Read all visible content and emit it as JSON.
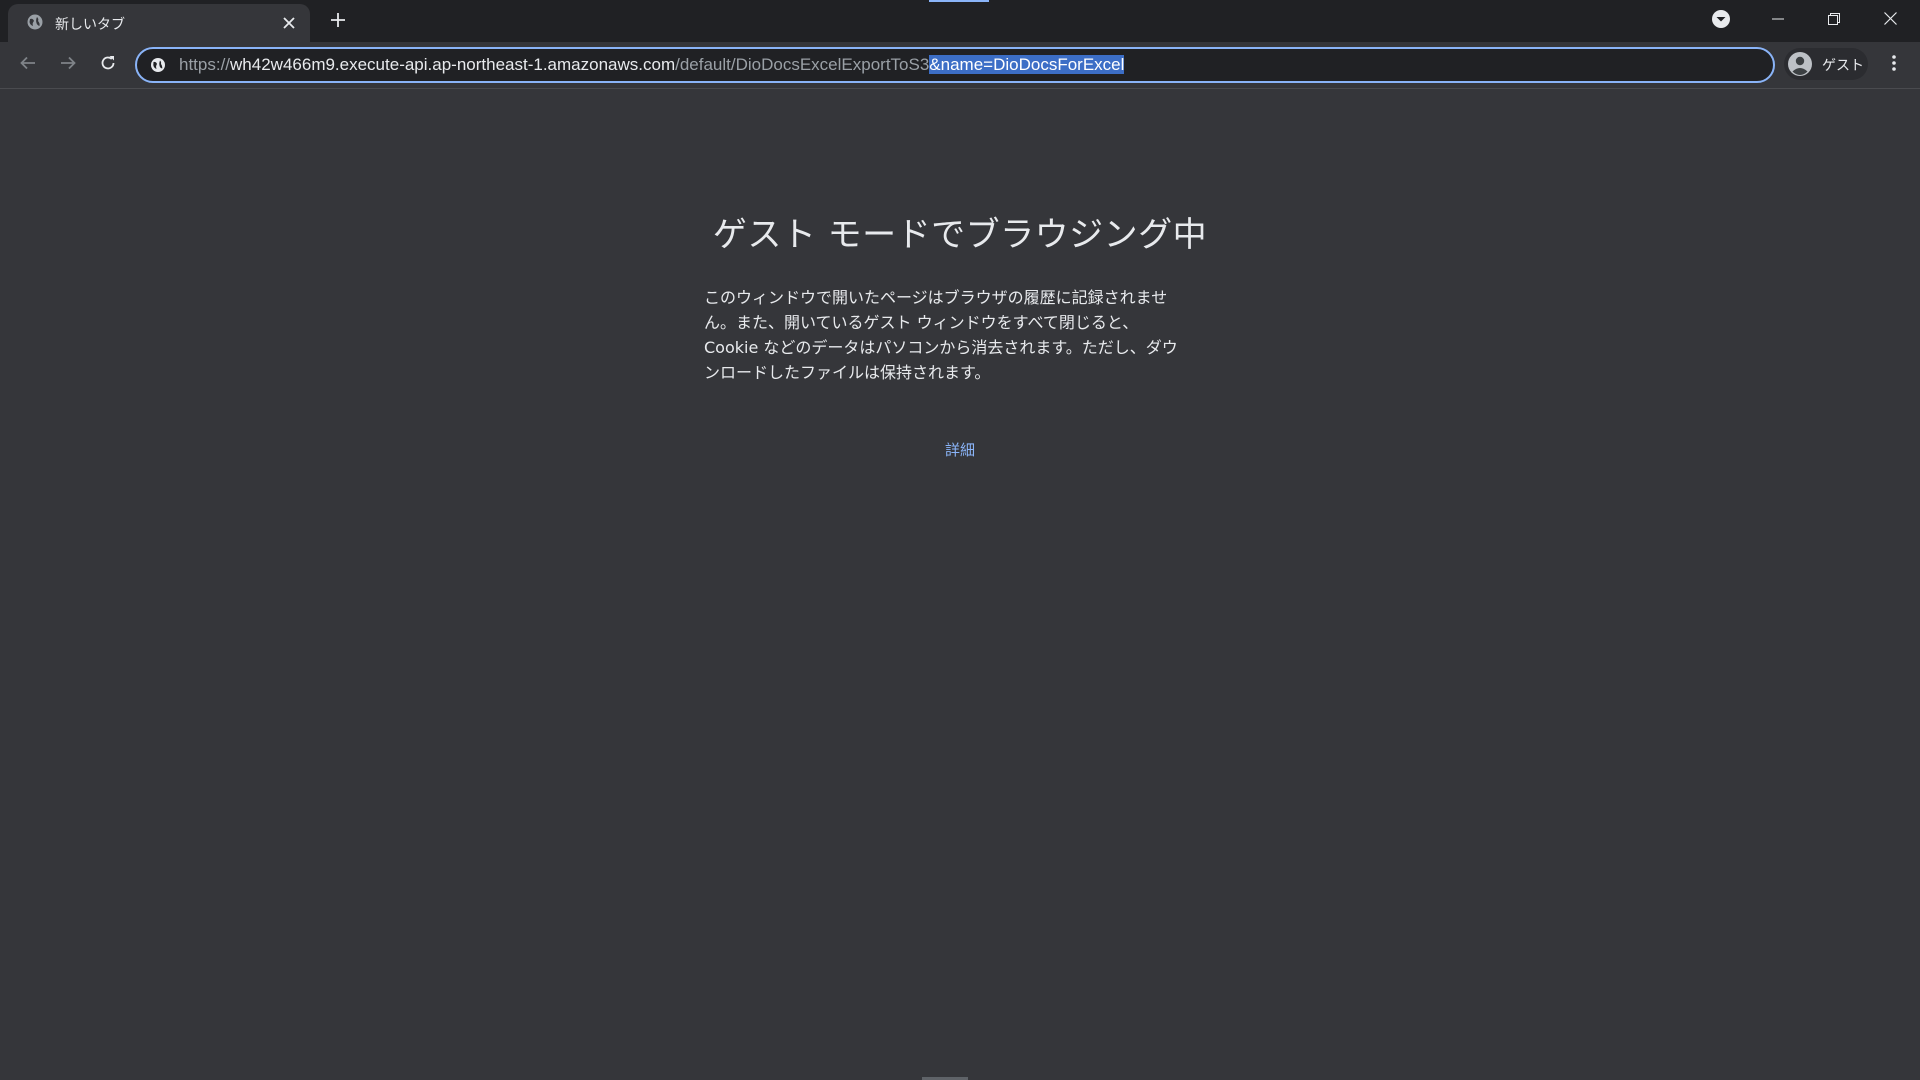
{
  "tab": {
    "title": "新しいタブ",
    "favicon": "globe-icon",
    "close": "close-icon"
  },
  "tabstrip": {
    "new_tab": "plus-icon",
    "tab_search": "chevron-down-circle-icon"
  },
  "window_controls": {
    "minimize": "minimize-icon",
    "maximize": "restore-icon",
    "close": "close-icon"
  },
  "toolbar": {
    "back": "arrow-left-icon",
    "forward": "arrow-right-icon",
    "reload": "reload-icon"
  },
  "omnibox": {
    "site_icon": "site-info-icon",
    "scheme": "https://",
    "host": "wh42w466m9.execute-api.ap-northeast-1.amazonaws.com",
    "path": "/default/DioDocsExcelExportToS3",
    "selected_query": "&name=DioDocsForExcel"
  },
  "profile": {
    "label": "ゲスト",
    "avatar": "account-circle-icon"
  },
  "menu": "more-vertical-icon",
  "page": {
    "title": "ゲスト モードでブラウジング中",
    "description_lines": [
      "このウィンドウで開いたページはブラウザの履歴に記録されませ",
      "ん。また、開いているゲスト ウィンドウをすべて閉じると、",
      "Cookie などのデータはパソコンから消去されます。ただし、ダウ",
      "ンロードしたファイルは保持されます。"
    ],
    "learn_more": "詳細"
  },
  "colors": {
    "frame": "#202124",
    "toolbar": "#35363a",
    "accent": "#8ab4f8",
    "text": "#e8eaed",
    "muted_text": "#9aa0a6",
    "selection": "#3c6ec6"
  }
}
